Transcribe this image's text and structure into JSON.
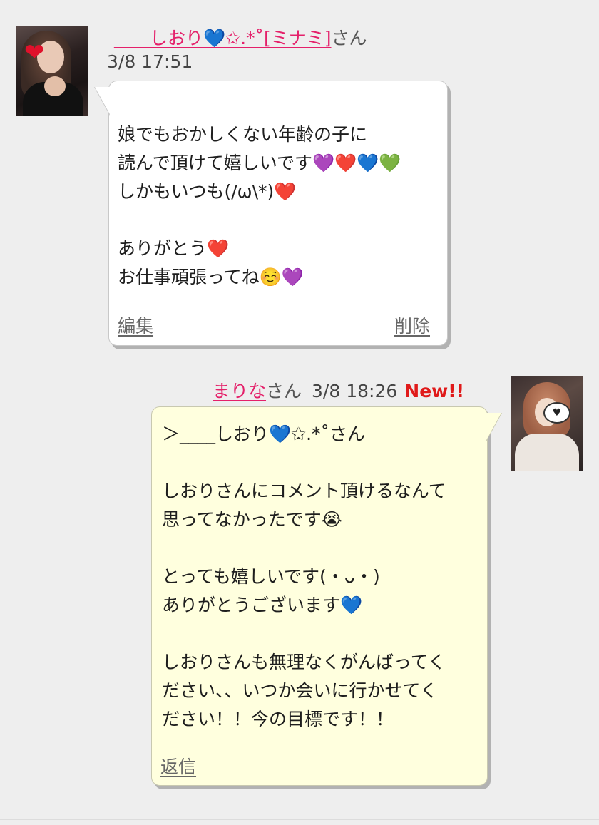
{
  "message1": {
    "name_prefix": "____しおり💙✩.*˚[ミナミ]",
    "honorific": "さん",
    "timestamp": "3/8 17:51",
    "body": "娘でもおかしくない年齢の子に\n読んで頂けて嬉しいです💜❤️💙💚\nしかもいつも(/ω\\*)❤️\n\nありがとう❤️\nお仕事頑張ってね☺️💜",
    "edit_label": "編集",
    "delete_label": "削除"
  },
  "message2": {
    "name": "まりな",
    "honorific": "さん",
    "timestamp": "3/8 18:26",
    "new_badge": "New!!",
    "body": "＞____しおり💙✩.*˚さん\n\nしおりさんにコメント頂けるなんて\n思ってなかったです😭\n\nとっても嬉しいです(・ᴗ・)\nありがとうございます💙\n\nしおりさんも無理なくがんばってく\nださい、、いつか会いに行かせてく\nださい！！今の目標です！！",
    "reply_label": "返信"
  },
  "colors": {
    "name_link": "#e4206a",
    "new_badge": "#e01a1a",
    "bubble_owner": "#ffffff",
    "bubble_reply": "#ffffde",
    "background": "#eeeeee"
  }
}
